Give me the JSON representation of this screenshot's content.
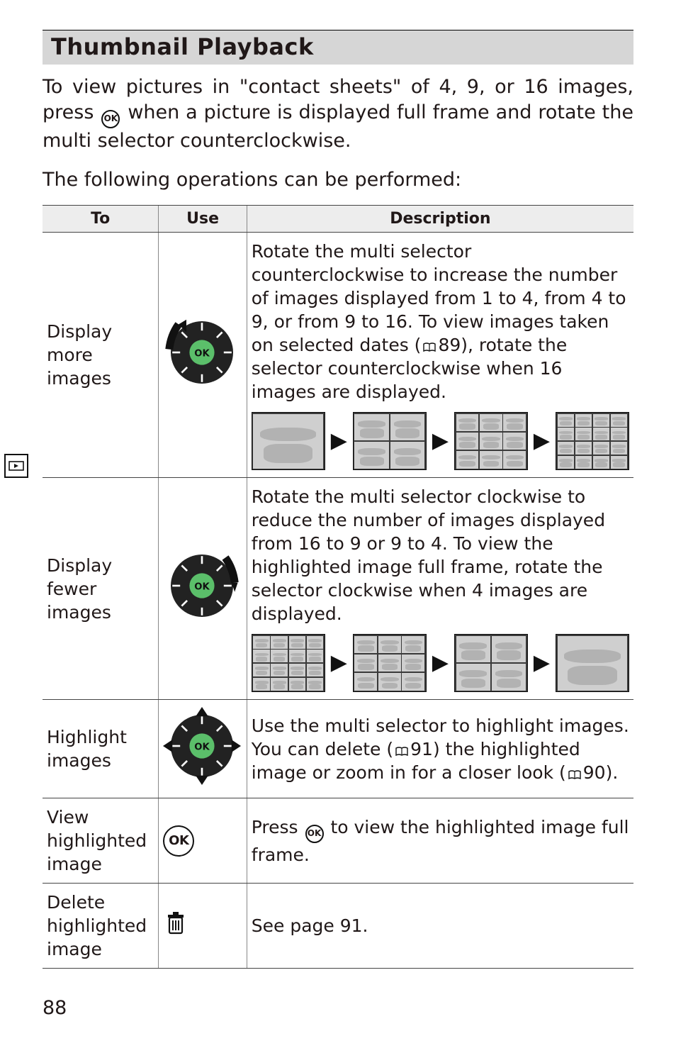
{
  "page_number": "88",
  "section": {
    "title": "Thumbnail Playback"
  },
  "intro": {
    "p1_a": "To view pictures in \"contact sheets\" of 4, 9, or 16 images, press ",
    "p1_b": " when a picture is displayed full frame and rotate the multi selector counterclockwise.",
    "p2": "The following operations can be performed:"
  },
  "table": {
    "headers": {
      "to": "To",
      "use": "Use",
      "desc": "Description"
    },
    "rows": [
      {
        "to": "Display more images",
        "use_icon": "dial-ccw",
        "desc_before": "Rotate the multi selector counterclockwise to increase the number of images displayed from 1 to 4, from 4 to 9, or from 9 to 16. To view images taken on selected dates (",
        "desc_ref": "89",
        "desc_after": "), rotate the selector counterclockwise when 16 images are displayed.",
        "strip": [
          "grid1",
          "grid4",
          "grid9",
          "grid16"
        ]
      },
      {
        "to": "Display fewer images",
        "use_icon": "dial-cw",
        "desc_before": "Rotate the multi selector clockwise to reduce the number of images displayed from 16 to 9 or 9 to 4. To view the highlighted image full frame, rotate the selector clockwise when 4 images are displayed.",
        "strip": [
          "grid16",
          "grid9",
          "grid4",
          "grid1"
        ]
      },
      {
        "to": "Highlight images",
        "use_icon": "dial-cross",
        "desc_before": "Use the multi selector to highlight images. You can delete (",
        "desc_ref": "91",
        "desc_mid": ") the highlighted image or zoom in for a closer look (",
        "desc_ref2": "90",
        "desc_after": ")."
      },
      {
        "to": "View highlighted image",
        "use_icon": "ok",
        "desc_before": "Press ",
        "desc_after": " to view the highlighted image full frame."
      },
      {
        "to": "Delete highlighted image",
        "use_icon": "trash",
        "desc_before": "See page 91."
      }
    ]
  }
}
